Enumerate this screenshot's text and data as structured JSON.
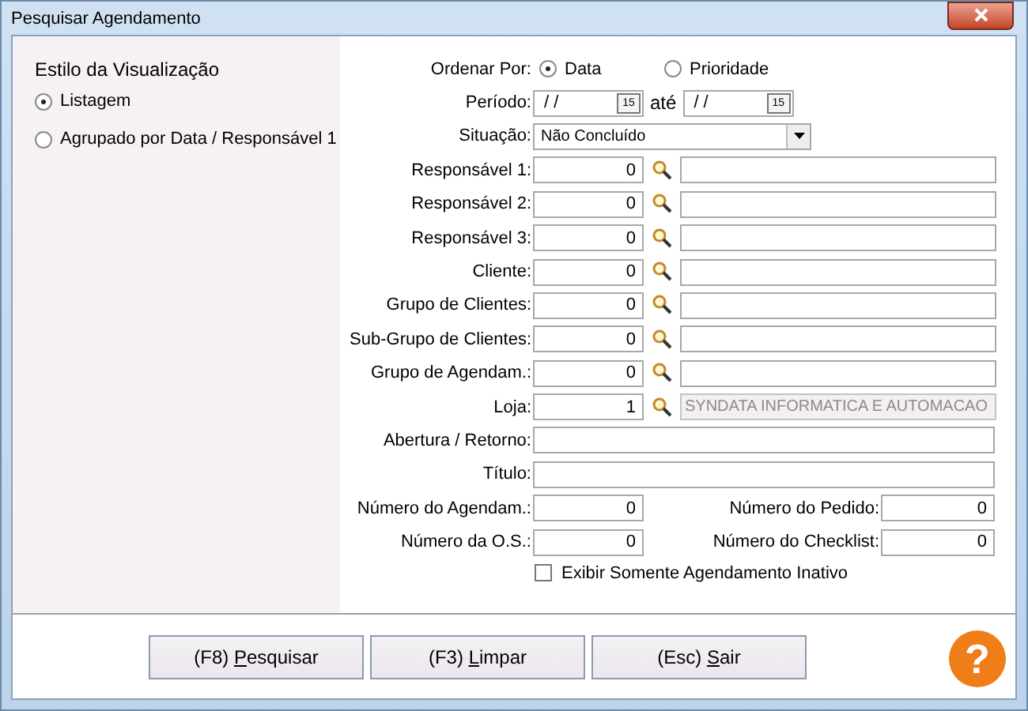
{
  "window": {
    "title": "Pesquisar Agendamento"
  },
  "view_style": {
    "title": "Estilo da Visualização",
    "options": [
      {
        "label": "Listagem",
        "selected": true
      },
      {
        "label": "Agrupado por Data / Responsável 1",
        "selected": false
      }
    ]
  },
  "order_by": {
    "label": "Ordenar Por:",
    "options": [
      {
        "label": "Data",
        "selected": true
      },
      {
        "label": "Prioridade",
        "selected": false
      }
    ]
  },
  "period": {
    "label": "Período:",
    "from": "/ /",
    "from_calendar": "15",
    "separator": "até",
    "to": "/ /",
    "to_calendar": "15"
  },
  "status": {
    "label": "Situação:",
    "value": "Não Concluído"
  },
  "lookups": [
    {
      "label": "Responsável 1:",
      "code": "0",
      "disabled": false
    },
    {
      "label": "Responsável 2:",
      "code": "0",
      "disabled": false
    },
    {
      "label": "Responsável 3:",
      "code": "0",
      "disabled": false
    },
    {
      "label": "Cliente:",
      "code": "0",
      "disabled": false
    },
    {
      "label": "Grupo de Clientes:",
      "code": "0",
      "disabled": false
    },
    {
      "label": "Sub-Grupo de Clientes:",
      "code": "0",
      "disabled": false
    },
    {
      "label": "Grupo de Agendam.:",
      "code": "0",
      "disabled": false
    },
    {
      "label": "Loja:",
      "code": "1",
      "name": "SYNDATA INFORMATICA E AUTOMACAO",
      "disabled": true
    }
  ],
  "text_fields": [
    {
      "label": "Abertura / Retorno:"
    },
    {
      "label": "Título:"
    }
  ],
  "number_rows": [
    {
      "left_label": "Número do Agendam.:",
      "left_value": "0",
      "right_label": "Número do Pedido:",
      "right_value": "0"
    },
    {
      "left_label": "Número da O.S.:",
      "left_value": "0",
      "right_label": "Número do Checklist:",
      "right_value": "0"
    }
  ],
  "inactive_only": {
    "label": "Exibir Somente Agendamento Inativo",
    "checked": false
  },
  "buttons": [
    {
      "prefix": "(F8) ",
      "key": "P",
      "rest": "esquisar"
    },
    {
      "prefix": "(F3) ",
      "key": "L",
      "rest": "impar"
    },
    {
      "prefix": "(Esc) ",
      "key": "S",
      "rest": "air"
    }
  ],
  "help": {
    "symbol": "?"
  }
}
